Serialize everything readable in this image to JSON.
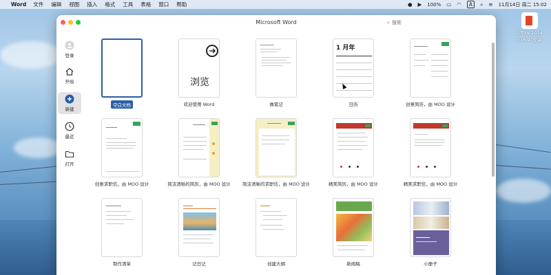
{
  "menubar": {
    "app_name": "Word",
    "menus": [
      "文件",
      "编辑",
      "视图",
      "插入",
      "格式",
      "工具",
      "表格",
      "窗口",
      "帮助"
    ],
    "battery": "100%",
    "input_method": "A",
    "datetime": "11月14日 周二  15:02"
  },
  "desktop": {
    "icon_label_line1": "Office 2024",
    "icon_label_line2": "v16.91安装"
  },
  "window": {
    "title": "Microsoft Word",
    "search_placeholder": "搜索"
  },
  "sidebar": {
    "items": [
      {
        "label": "登录",
        "icon": "person-icon"
      },
      {
        "label": "开始",
        "icon": "home-icon"
      },
      {
        "label": "新建",
        "icon": "plus-icon",
        "active": true
      },
      {
        "label": "最近",
        "icon": "clock-icon"
      },
      {
        "label": "打开",
        "icon": "folder-icon"
      }
    ]
  },
  "templates": [
    {
      "label": "空白文档",
      "selected": true
    },
    {
      "label": "欢迎使用 Word",
      "thumb_text": "浏览"
    },
    {
      "label": "做笔记"
    },
    {
      "label": "日历",
      "thumb_text": "1 月年"
    },
    {
      "label": "创意简历，由 MOO 设计"
    },
    {
      "label": "创意求职信，由 MOO 设计"
    },
    {
      "label": "简洁清晰的简历，由 MOO 设计"
    },
    {
      "label": "简洁清晰的求职信，由 MOO 设计"
    },
    {
      "label": "精美简历，由 MOO 设计"
    },
    {
      "label": "精美求职信，由 MOO 设计"
    },
    {
      "label": "制作清单"
    },
    {
      "label": "记日记"
    },
    {
      "label": "创建大纲"
    },
    {
      "label": "新闻稿"
    },
    {
      "label": "小册子"
    }
  ],
  "colors": {
    "accent": "#2a5ea8",
    "active_sidebar": "#e3e3e6",
    "moo_green": "#3aa35b",
    "moo_red": "#c0392b"
  }
}
